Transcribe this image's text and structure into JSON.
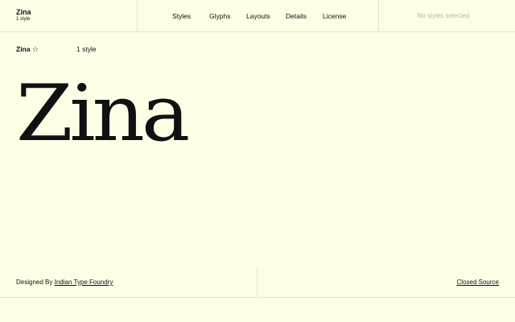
{
  "header": {
    "brand_name": "Zina",
    "brand_subtitle": "1 style",
    "nav": [
      {
        "label": "Styles"
      },
      {
        "label": "Glyphs"
      },
      {
        "label": "Layouts"
      },
      {
        "label": "Details"
      },
      {
        "label": "License"
      }
    ],
    "status": "No styles selected"
  },
  "family": {
    "name": "Zina",
    "style_count": "1 style",
    "star_icon": "star-outline-icon"
  },
  "specimen": {
    "text": "Zina"
  },
  "footer": {
    "designed_by_prefix": "Designed By ",
    "foundry": "Indian Type Foundry",
    "license": "Closed Source"
  },
  "colors": {
    "background": "#fefee6",
    "text": "#111111",
    "divider": "#e6e6cf",
    "muted": "#b9b9a4"
  }
}
